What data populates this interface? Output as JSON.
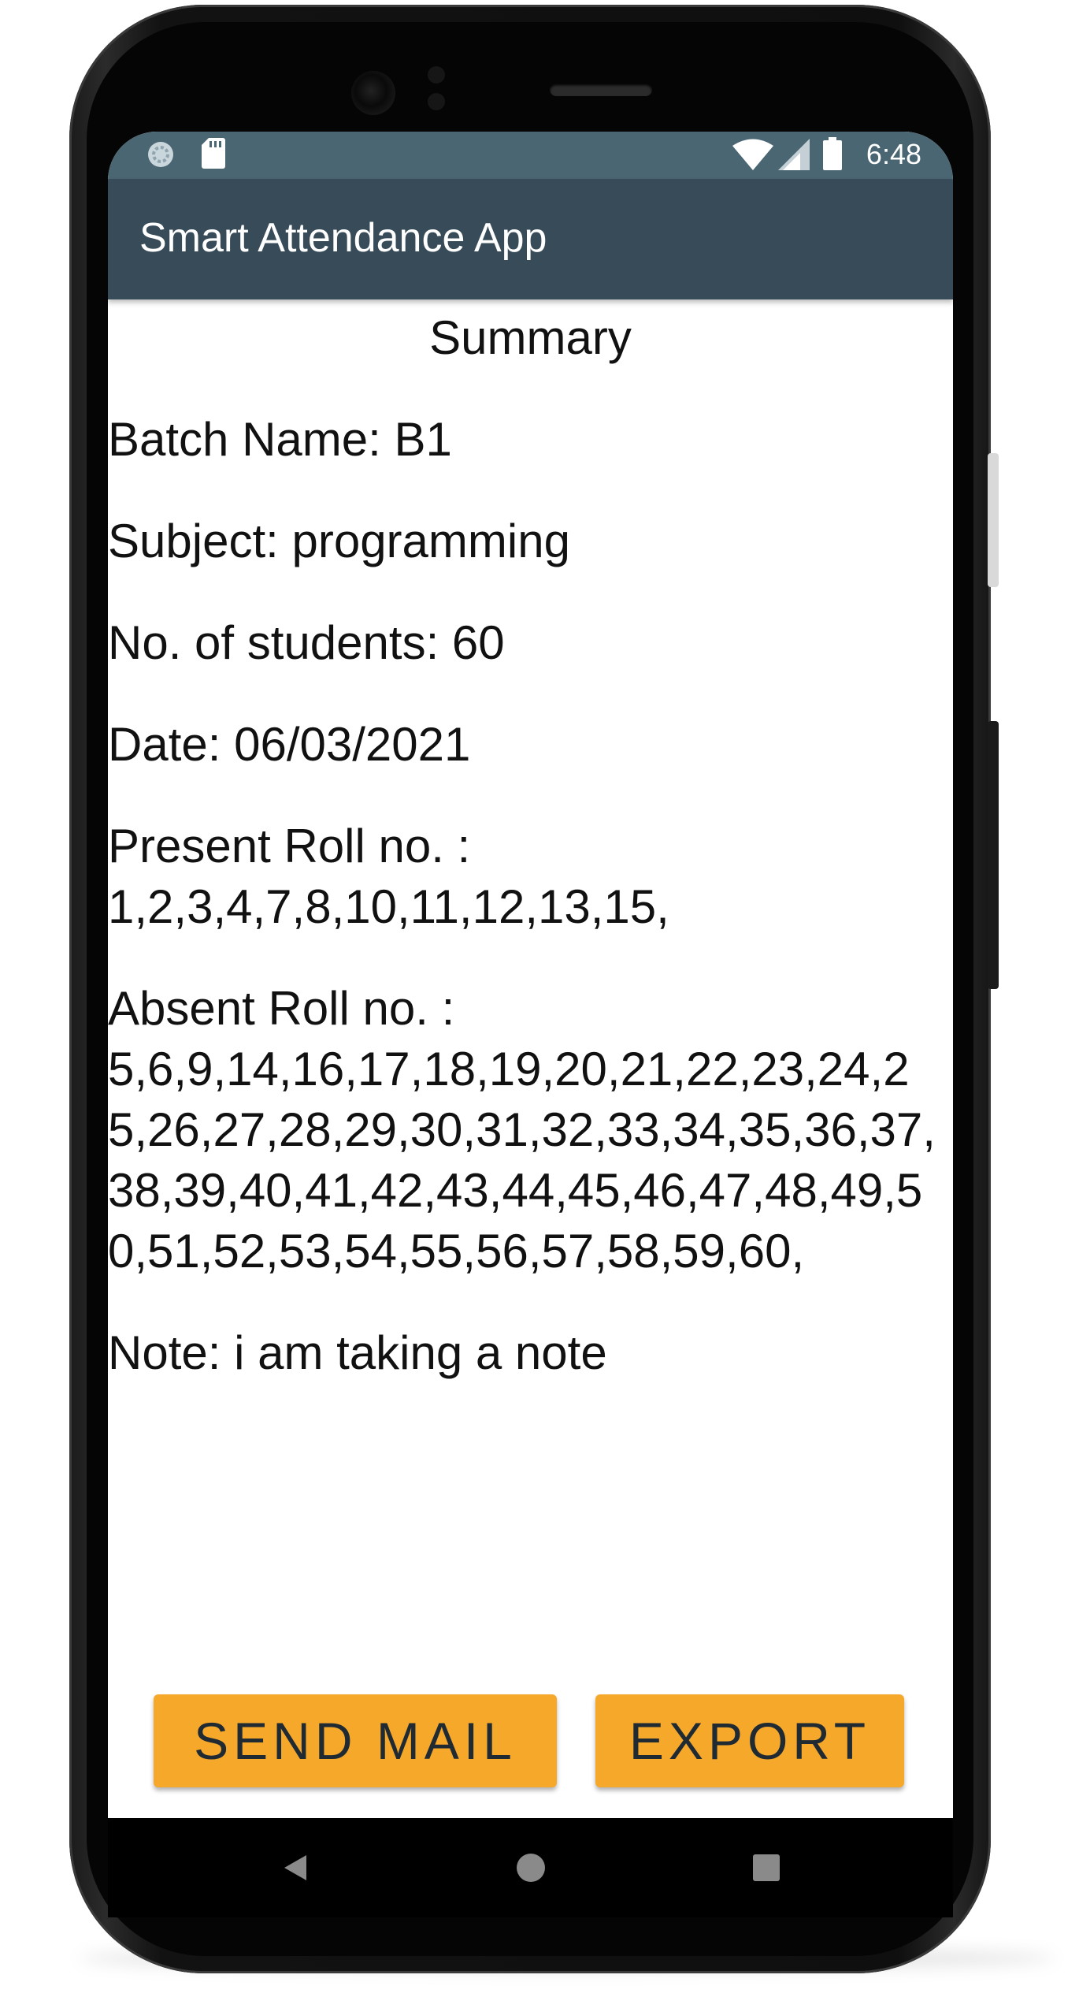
{
  "status_bar": {
    "time": "6:48",
    "icons": [
      "media-scanner-icon",
      "sd-card-icon",
      "wifi-icon",
      "cell-signal-icon",
      "battery-icon"
    ]
  },
  "app_bar": {
    "title": "Smart Attendance App"
  },
  "summary": {
    "heading": "Summary",
    "batch": {
      "label": "Batch Name: ",
      "value": "B1"
    },
    "subject": {
      "label": "Subject: ",
      "value": "programming"
    },
    "students": {
      "label": "No. of students: ",
      "value": "60"
    },
    "date": {
      "label": "Date: ",
      "value": "06/03/2021"
    },
    "present": {
      "label": "Present Roll no. : ",
      "value": "1,2,3,4,7,8,10,11,12,13,15,"
    },
    "absent": {
      "label": "Absent Roll no. : ",
      "value": "5,6,9,14,16,17,18,19,20,21,22,23,24,25,26,27,28,29,30,31,32,33,34,35,36,37,38,39,40,41,42,43,44,45,46,47,48,49,50,51,52,53,54,55,56,57,58,59,60,"
    },
    "note": {
      "label": "Note: ",
      "value": "i am taking a note"
    }
  },
  "actions": {
    "send_mail": "SEND MAIL",
    "export": "EXPORT"
  },
  "colors": {
    "status_bar": "#4a6672",
    "app_bar": "#384b59",
    "button": "#f6a82b",
    "button_text": "#1f2a33"
  },
  "nav_bar": {
    "icons": [
      "back-icon",
      "home-icon",
      "recents-icon"
    ]
  }
}
